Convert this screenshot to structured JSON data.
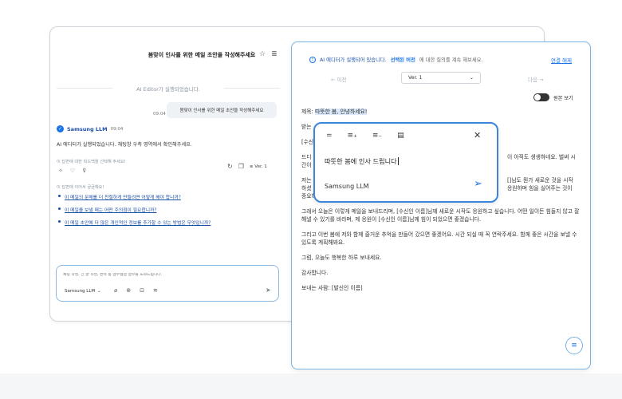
{
  "chat": {
    "title": "봄맞이 인사를 위한 메일 초안을 작성해주세요",
    "header_icons": [
      "download-icon",
      "star-icon",
      "menu-icon"
    ],
    "system_message": "AI Editor가 실행되었습니다.",
    "user_message": {
      "text": "봄맞이 인사를 위한 메일 초안을 작성해주세요",
      "time": "09:04"
    },
    "llm": {
      "name": "Samsung LLM",
      "time": "09:04",
      "message": "AI 에디터가 실행되었습니다. 채팅창 우측 영역에서 확인해주세요."
    },
    "feedback_prompt": "이 답변에 대한 피드백을 선택해 주세요!",
    "version_label": "Ver. 1",
    "follow_prompt": "이 답변에 이어서 궁금해요!",
    "follow_ups": [
      "이 메일의 문체를 더 친절하게 만들려면 어떻게 해야 합니까?",
      "이 메일을 보낼 때는 어떤 주의점이 필요합니까?",
      "이 메일 초안에 더 많은 개인적인 정보를 추가할 수 있는 방법은 무엇입니까?"
    ],
    "input": {
      "placeholder": "채팅 작성, 긴 글 작성, 번역 등 업무협업 업무를 도와드립니다.",
      "model": "Samsung LLM"
    }
  },
  "editor": {
    "info_prefix": "AI 에디터가 실행되어 있습니다.",
    "info_highlight": "선택된 버전",
    "info_suffix": "에 대한 질의를 계속 해보세요.",
    "cancel_link": "연결 해제",
    "nav_prev": "← 이전",
    "version": "Ver. 1",
    "nav_next": "다음 →",
    "original_toggle": "원본 보기",
    "subject_label": "제목:",
    "subject_value": "따뜻한 봄, 안녕하세요!",
    "paragraphs": [
      "받는",
      "[수신",
      "드디",
      "저는",
      "그래서 오늘은 이렇게 메일을 보내드리며, [수신인 이름]님께 새로운 시작도 응원하고 싶습니다. 어떤 일이든 힘들지 않고 잘 해낼 수 있기를 바라며, 제 응원이 [수신인 이름]님께 힘이 되었으면 좋겠습니다.",
      "그리고 이번 봄에 저와 함께 즐거운 추억을 만들어 갔으면 좋겠어요. 시간 되실 때 꼭 연락주세요. 함께 좋은 시간을 보낼 수 있도록 계획해봐요.",
      "그럼, 오늘도 행복한 하루 보내세요.",
      "감사합니다.",
      "보내는 사람: [발신인 이름]"
    ],
    "partial_right": [
      "이 아직도 생생하네요. 벌써 시",
      "[]님도 뭔가 새로운 것을 시작",
      "응원하며 힘을 실어주는 것이"
    ],
    "partial_left_tail": [
      "간이",
      "하셨",
      "중요하다고 생각합니다."
    ]
  },
  "popup": {
    "tools": [
      "equals-icon",
      "add-lines-icon",
      "remove-lines-icon",
      "document-icon"
    ],
    "text": "따뜻한 봄에 인사 드립니다",
    "model": "Samsung LLM"
  }
}
